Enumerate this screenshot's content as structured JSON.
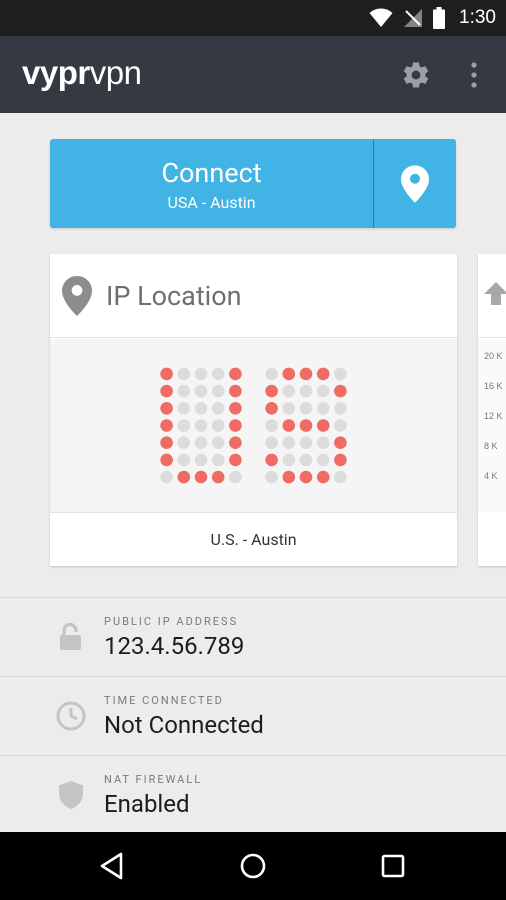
{
  "status_bar": {
    "time": "1:30"
  },
  "app_bar": {
    "brand_bold": "vypr",
    "brand_light": "vpn"
  },
  "connect": {
    "label": "Connect",
    "location": "USA - Austin"
  },
  "ip_card": {
    "title": "IP Location",
    "display_text": "U.S.",
    "location": "U.S. - Austin",
    "accent_color": "#ef6b64",
    "dot_color": "#dcdcdc"
  },
  "peek_card": {
    "ticks": [
      "20 K",
      "16 K",
      "12 K",
      "8 K",
      "4 K"
    ]
  },
  "info": {
    "public_ip": {
      "label": "PUBLIC IP ADDRESS",
      "value": "123.4.56.789"
    },
    "time_connected": {
      "label": "TIME CONNECTED",
      "value": "Not Connected"
    },
    "nat_firewall": {
      "label": "NAT FIREWALL",
      "value": "Enabled"
    }
  }
}
